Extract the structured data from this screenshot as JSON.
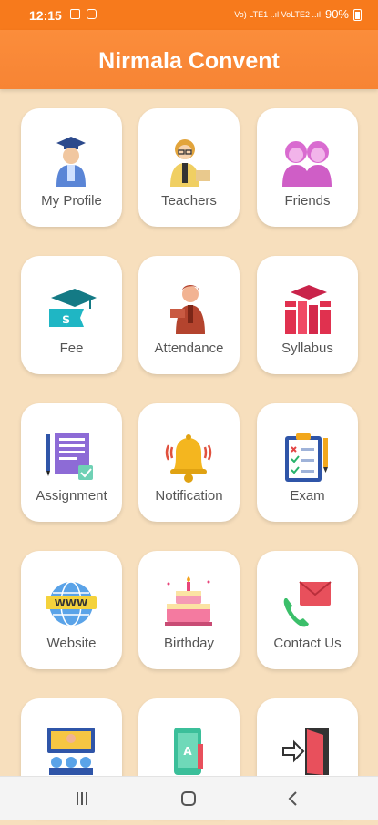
{
  "status_bar": {
    "time": "12:15",
    "network": "Vo) LTE1 ..ıl VoLTE2 ..ıl",
    "battery": "90%"
  },
  "app_bar": {
    "title": "Nirmala Convent"
  },
  "menu": [
    {
      "label": "My Profile",
      "icon": "graduate-student-icon"
    },
    {
      "label": "Teachers",
      "icon": "teacher-icon"
    },
    {
      "label": "Friends",
      "icon": "friends-icon"
    },
    {
      "label": "Fee",
      "icon": "fee-ticket-icon"
    },
    {
      "label": "Attendance",
      "icon": "attendance-icon"
    },
    {
      "label": "Syllabus",
      "icon": "books-icon"
    },
    {
      "label": "Assignment",
      "icon": "assignment-icon"
    },
    {
      "label": "Notification",
      "icon": "bell-icon"
    },
    {
      "label": "Exam",
      "icon": "exam-clipboard-icon"
    },
    {
      "label": "Website",
      "icon": "globe-www-icon"
    },
    {
      "label": "Birthday",
      "icon": "birthday-cake-icon"
    },
    {
      "label": "Contact Us",
      "icon": "contact-phone-icon"
    },
    {
      "label": "",
      "icon": "online-class-icon"
    },
    {
      "label": "",
      "icon": "mobile-app-icon"
    },
    {
      "label": "",
      "icon": "logout-door-icon"
    }
  ],
  "colors": {
    "primary": "#f77a1c",
    "background": "#f7dfbd"
  }
}
